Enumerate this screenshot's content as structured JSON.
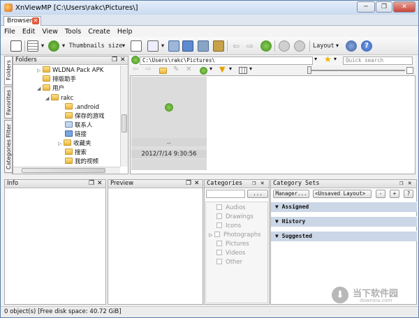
{
  "window": {
    "title": "XnViewMP [C:\\Users\\rakc\\Pictures\\]",
    "minimize": "─",
    "restore": "❐",
    "close": "✕"
  },
  "tab": {
    "label": "Browser",
    "close": "✕"
  },
  "menu": [
    "File",
    "Edit",
    "View",
    "Tools",
    "Create",
    "Help"
  ],
  "toolbar": {
    "thumbnails_label": "Thumbnails size",
    "layout_label": "Layout"
  },
  "sidetabs": [
    "Folders",
    "Favorites",
    "Categories Filter"
  ],
  "folders": {
    "title": "Folders",
    "items": [
      "WLDNA Pack APK",
      "排版助手",
      "用户",
      "rakc",
      ".android",
      "保存的游戏",
      "联系人",
      "链接",
      "收藏夹",
      "搜索",
      "我的视频"
    ]
  },
  "address": {
    "path": "C:\\Users\\rakc\\Pictures\\",
    "search_placeholder": "Quick search"
  },
  "browser": {
    "thumb_name": "..",
    "thumb_date": "2012/7/14 9:30:56"
  },
  "panels": {
    "info": "Info",
    "preview": "Preview",
    "categories": "Categories",
    "category_sets": "Category Sets"
  },
  "categories": {
    "items": [
      "Audios",
      "Drawings",
      "Icons",
      "Photographs",
      "Pictures",
      "Videos",
      "Other"
    ],
    "dropdown": "..."
  },
  "category_sets": {
    "manager": "Manager...",
    "layout": "<Unsaved Layout>",
    "minus": "-",
    "plus": "+",
    "question": "?",
    "rows": [
      "Assigned",
      "History",
      "Suggested"
    ]
  },
  "status": {
    "text": "0 object(s) [Free disk space: 40.72 GiB]"
  },
  "watermark": {
    "line1": "当下软件园",
    "line2": "downxia.com"
  },
  "colors": {
    "accent": "#2a6fc9",
    "header_blue": "#cbd6e6"
  }
}
